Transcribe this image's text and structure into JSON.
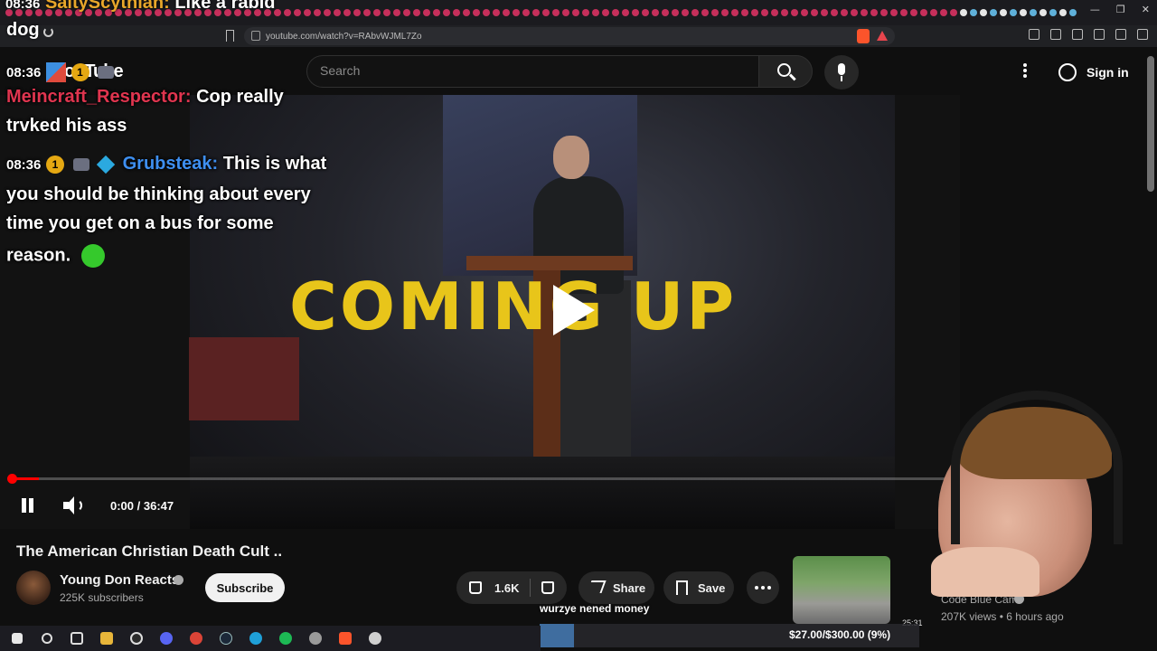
{
  "browser": {
    "url": "youtube.com/watch?v=RAbvWJML7Zo",
    "controls": {
      "minimize": "—",
      "maximize": "❐",
      "close": "✕"
    }
  },
  "overlay_chat": {
    "top_timestamp": "08:36",
    "top_name": "SaltyScythian:",
    "top_message": "Like a rabid",
    "top_message_cont": "dog",
    "messages": [
      {
        "timestamp": "08:36",
        "name": "Meincraft_Respector:",
        "name_color": "#e0354f",
        "lines": [
          "Cop really",
          "trvked his ass"
        ]
      },
      {
        "timestamp": "08:36",
        "name": "Grubsteak:",
        "name_color": "#3e8ff0",
        "lines": [
          "This is what",
          "you should be thinking about every",
          "time you get on a bus for some",
          "reason."
        ]
      }
    ],
    "badge_number": "1"
  },
  "youtube": {
    "logo": "YouTube",
    "search_placeholder": "Search",
    "sign_in": "Sign in"
  },
  "player": {
    "overlay_text": "COMING UP",
    "time": "0:00 / 36:47",
    "progress": 0.03
  },
  "video": {
    "title": "The American Christian Death Cult ..",
    "channel_name": "Young Don Reacts",
    "subscribers": "225K subscribers",
    "subscribe_label": "Subscribe",
    "likes": "1.6K",
    "share_label": "Share",
    "save_label": "Save"
  },
  "recommendation": {
    "channel": "Code Blue Cam",
    "meta": "207K views • 6 hours ago",
    "duration": "25:31"
  },
  "stream": {
    "donation_text": "wurzye nened money",
    "goal_text": "$27.00/$300.00 (9%)",
    "goal_progress": 0.09
  },
  "colors": {
    "accent_red": "#ff0000",
    "coming_up_yellow": "#e8c51a"
  }
}
